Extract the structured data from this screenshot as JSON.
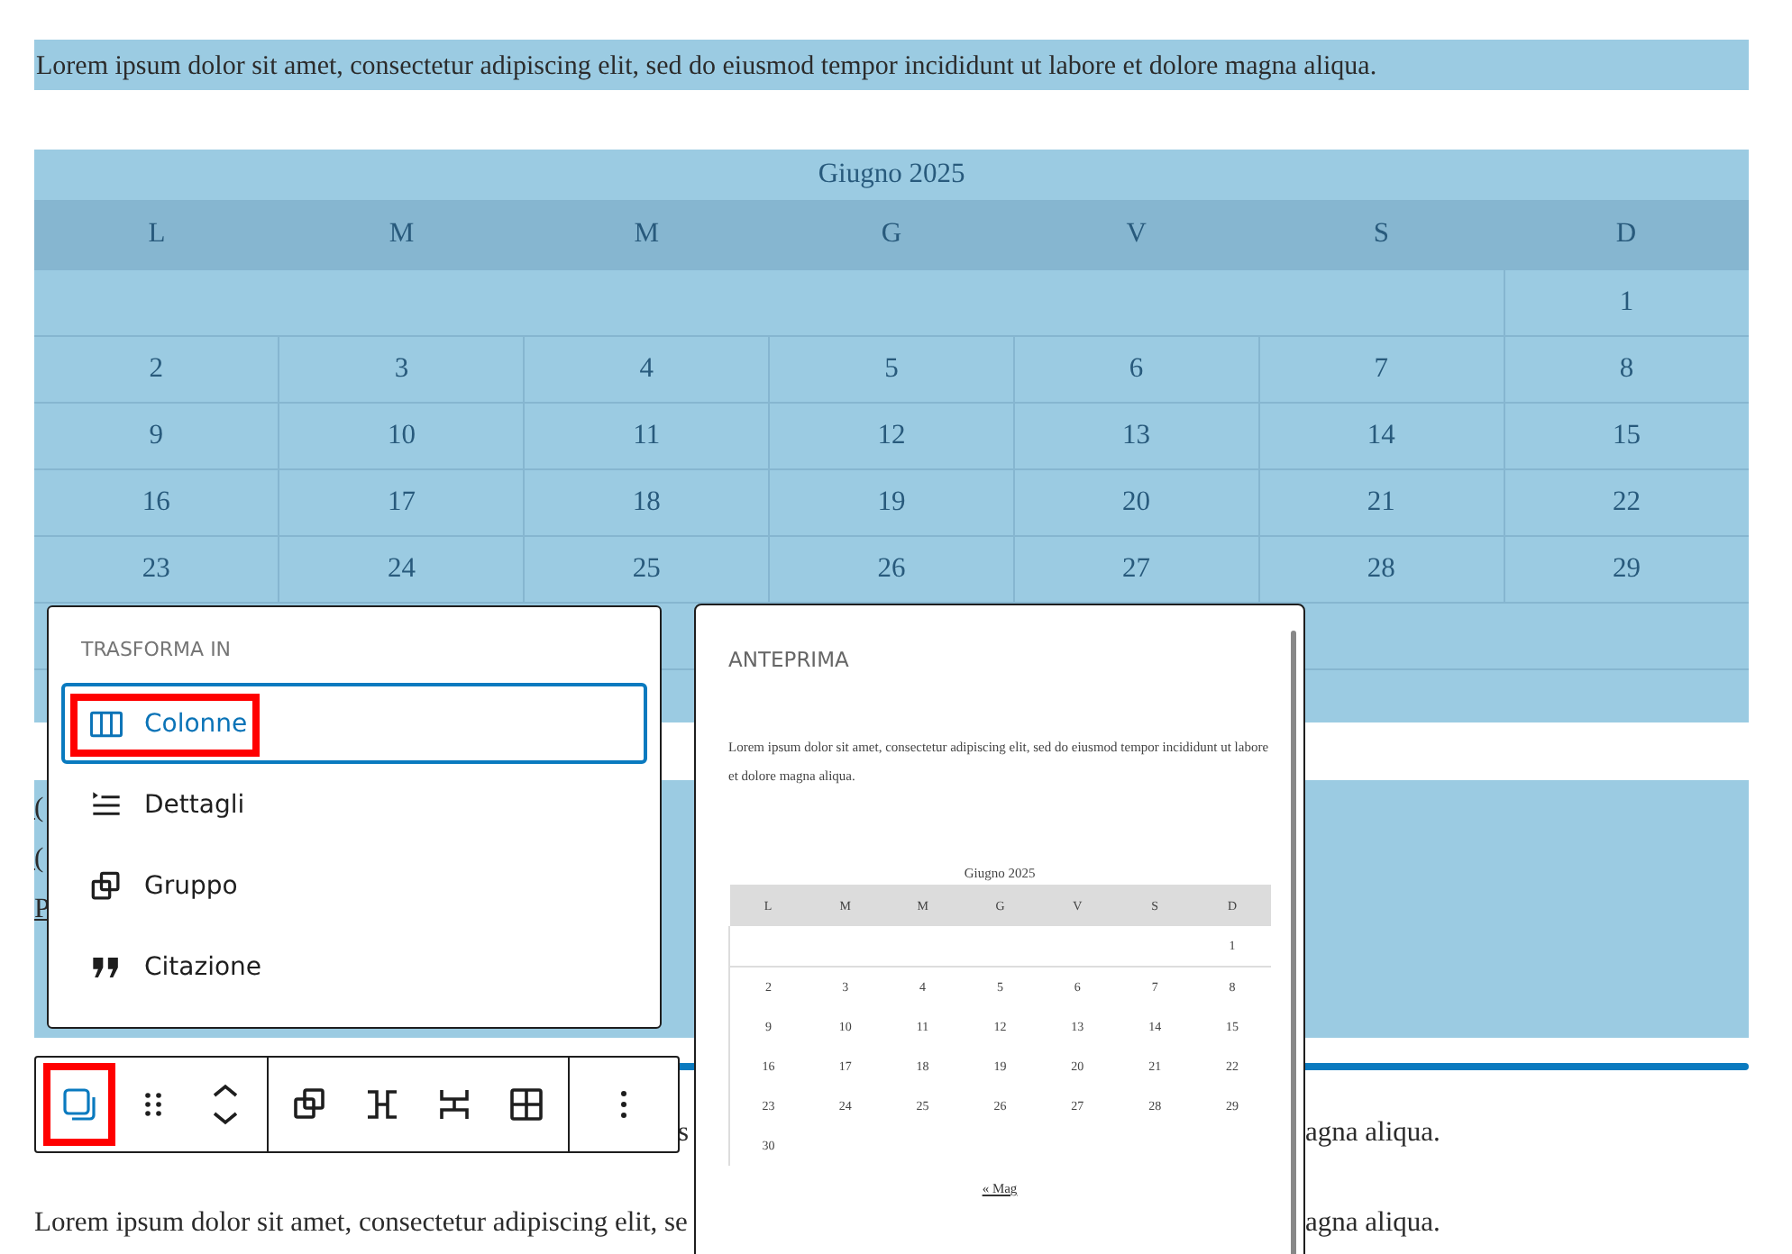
{
  "intro": "Lorem ipsum dolor sit amet, consectetur adipiscing elit, sed do eiusmod tempor incididunt ut labore et dolore magna aliqua.",
  "calendar": {
    "caption": "Giugno 2025",
    "days": [
      "L",
      "M",
      "M",
      "G",
      "V",
      "S",
      "D"
    ],
    "weeks": [
      {
        "days": [
          "1"
        ],
        "blank_before": true
      },
      {
        "days": [
          "2",
          "3",
          "4",
          "5",
          "6",
          "7",
          "8"
        ]
      },
      {
        "days": [
          "9",
          "10",
          "11",
          "12",
          "13",
          "14",
          "15"
        ]
      },
      {
        "days": [
          "16",
          "17",
          "18",
          "19",
          "20",
          "21",
          "22"
        ]
      },
      {
        "days": [
          "23",
          "24",
          "25",
          "26",
          "27",
          "28",
          "29"
        ]
      }
    ]
  },
  "links": [
    "(",
    "(",
    "P"
  ],
  "paragraphs": [
    {
      "fragments": [
        "s",
        "agna aliqua."
      ]
    },
    {
      "fragments": [
        "Lorem ipsum dolor sit amet, consectetur adipiscing elit, se",
        "agna aliqua."
      ]
    }
  ],
  "transform_menu": {
    "title": "TRASFORMA IN",
    "items": [
      {
        "kind": "columns",
        "label": "Colonne",
        "selected": true,
        "highlighted": true
      },
      {
        "kind": "details",
        "label": "Dettagli",
        "selected": false,
        "highlighted": false
      },
      {
        "kind": "group",
        "label": "Gruppo",
        "selected": false,
        "highlighted": false
      },
      {
        "kind": "quote",
        "label": "Citazione",
        "selected": false,
        "highlighted": false
      }
    ]
  },
  "toolbar": {
    "groups": [
      [
        {
          "kind": "transform",
          "highlighted": true
        },
        {
          "kind": "drag",
          "highlighted": false
        },
        {
          "kind": "move",
          "highlighted": false
        }
      ],
      [
        {
          "kind": "group",
          "highlighted": false
        },
        {
          "kind": "row",
          "highlighted": false
        },
        {
          "kind": "stack",
          "highlighted": false
        },
        {
          "kind": "grid",
          "highlighted": false
        }
      ],
      [
        {
          "kind": "more",
          "highlighted": false
        }
      ]
    ]
  },
  "preview": {
    "title": "ANTEPRIMA",
    "text": "Lorem ipsum dolor sit amet, consectetur adipiscing elit, sed do eiusmod tempor incididunt ut labore et dolore magna aliqua.",
    "calendar": {
      "caption": "Giugno 2025",
      "days": [
        "L",
        "M",
        "M",
        "G",
        "V",
        "S",
        "D"
      ],
      "weeks": [
        {
          "days": [
            "1"
          ],
          "blank_before": true
        },
        {
          "days": [
            "2",
            "3",
            "4",
            "5",
            "6",
            "7",
            "8"
          ]
        },
        {
          "days": [
            "9",
            "10",
            "11",
            "12",
            "13",
            "14",
            "15"
          ]
        },
        {
          "days": [
            "16",
            "17",
            "18",
            "19",
            "20",
            "21",
            "22"
          ]
        },
        {
          "days": [
            "23",
            "24",
            "25",
            "26",
            "27",
            "28",
            "29"
          ]
        },
        {
          "days": [
            "30"
          ],
          "blank_before": false
        }
      ],
      "nav": "« Mag"
    }
  }
}
